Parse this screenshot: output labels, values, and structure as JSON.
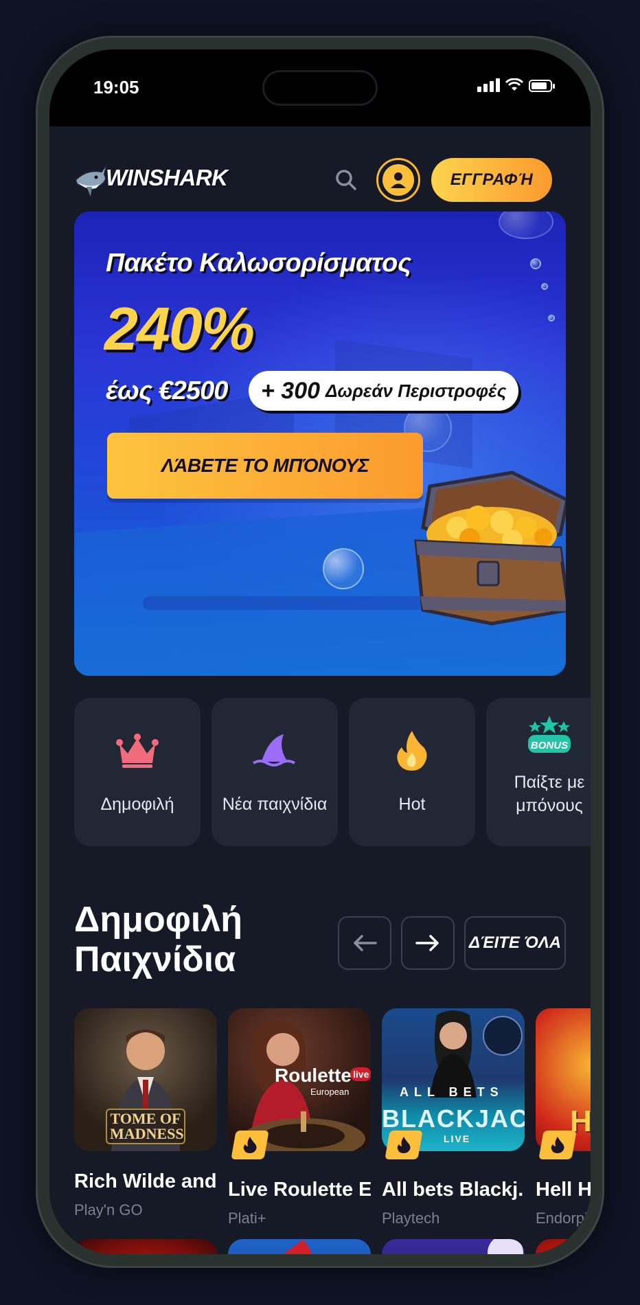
{
  "status_bar": {
    "time": "19:05"
  },
  "header": {
    "logo_text": "WINSHARK",
    "register_label": "ΕΓΓΡΑΦΉ"
  },
  "hero": {
    "title": "Πακέτο Καλωσορίσματος",
    "percent": "240%",
    "up_to": "έως €2500",
    "free_spins_count": "+ 300",
    "free_spins_text": "Δωρεάν Περιστροφές",
    "cta_label": "ΛΆΒΕΤΕ ΤΟ ΜΠΌΝΟΥΣ"
  },
  "categories": [
    {
      "label": "Δημοφιλή",
      "icon": "crown-icon"
    },
    {
      "label": "Νέα παιχνίδια",
      "icon": "shark-fin-icon"
    },
    {
      "label": "Hot",
      "icon": "flame-icon"
    },
    {
      "label": "Παίξτε με μπόνους",
      "icon": "bonus-icon",
      "badge": "BONUS"
    }
  ],
  "popular": {
    "title": "Δημοφιλή Παιχνίδια",
    "see_all_label": "ΔΈΙΤΕ ΌΛΑ",
    "games": [
      {
        "title": "Rich Wilde and...",
        "provider": "Play'n GO",
        "thumb_text": "TOME OF MADNESS"
      },
      {
        "title": "Live Roulette E...",
        "provider": "Plati+",
        "thumb_text": "Roulette",
        "thumb_sub": "European",
        "thumb_badge": "live"
      },
      {
        "title": "All bets Blackj...",
        "provider": "Playtech",
        "thumb_text": "BLACKJACK",
        "thumb_sub": "LIVE",
        "thumb_top": "ALL BETS"
      },
      {
        "title": "Hell Hot",
        "provider": "Endorphina",
        "thumb_text": "HE"
      }
    ]
  },
  "colors": {
    "background": "#151a26",
    "accent": "#fbbf3b",
    "card": "#222736"
  }
}
